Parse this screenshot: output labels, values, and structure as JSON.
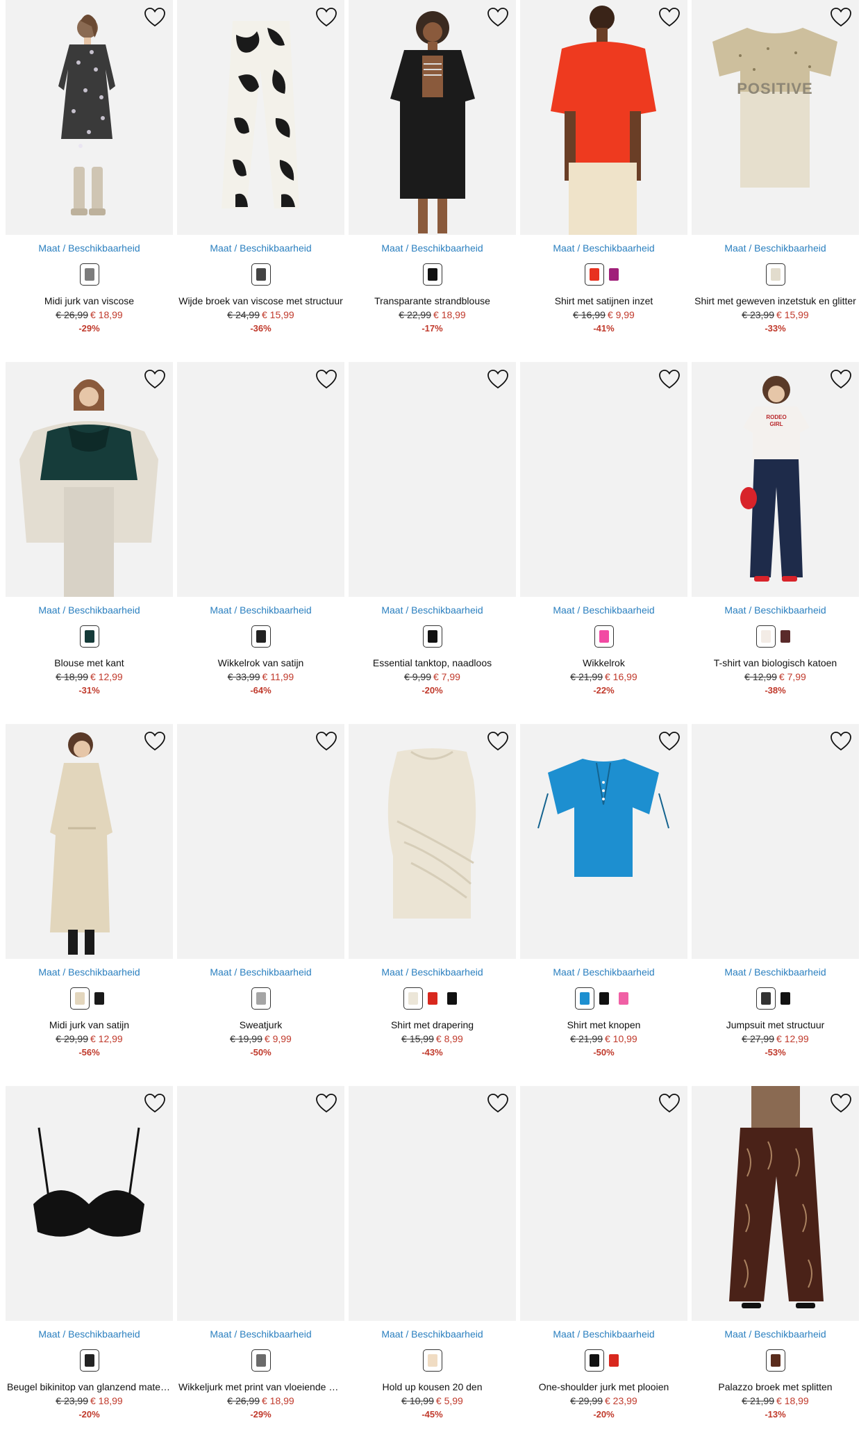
{
  "size_link_label": "Maat / Beschikbaarheid",
  "colors": {
    "link": "#2a7fbf",
    "sale": "#c0392b",
    "placeholder": "#f2f2f2"
  },
  "products": [
    {
      "name": "Midi jurk van viscose",
      "old": "€ 26,99",
      "new": "€ 18,99",
      "disc": "-29%",
      "image": "floral-dress-model",
      "swatches": [
        "#7c7c7c"
      ]
    },
    {
      "name": "Wijde broek van viscose met structuur",
      "old": "€ 24,99",
      "new": "€ 15,99",
      "disc": "-36%",
      "image": "patterned-trousers",
      "swatches": [
        "#444444"
      ]
    },
    {
      "name": "Transparante strandblouse",
      "old": "€ 22,99",
      "new": "€ 18,99",
      "disc": "-17%",
      "image": "black-beach-blouse-model",
      "swatches": [
        "#111111"
      ]
    },
    {
      "name": "Shirt met satijnen inzet",
      "old": "€ 16,99",
      "new": "€ 9,99",
      "disc": "-41%",
      "image": "red-shirt-model",
      "swatches": [
        "#e8321f",
        "#a0207a"
      ]
    },
    {
      "name": "Shirt met geweven inzetstuk en glitter",
      "old": "€ 23,99",
      "new": "€ 15,99",
      "disc": "-33%",
      "image": "positive-tshirt",
      "swatches": [
        "#e2dccd"
      ]
    },
    {
      "name": "Blouse met kant",
      "old": "€ 18,99",
      "new": "€ 12,99",
      "disc": "-31%",
      "image": "green-lace-blouse-model",
      "swatches": [
        "#143a38"
      ]
    },
    {
      "name": "Wikkelrok van satijn",
      "old": "€ 33,99",
      "new": "€ 11,99",
      "disc": "-64%",
      "image": "",
      "swatches": [
        "#222222"
      ]
    },
    {
      "name": "Essential tanktop, naadloos",
      "old": "€ 9,99",
      "new": "€ 7,99",
      "disc": "-20%",
      "image": "",
      "swatches": [
        "#111111"
      ]
    },
    {
      "name": "Wikkelrok",
      "old": "€ 21,99",
      "new": "€ 16,99",
      "disc": "-22%",
      "image": "",
      "swatches": [
        "#f24aa3"
      ]
    },
    {
      "name": "T-shirt van biologisch katoen",
      "old": "€ 12,99",
      "new": "€ 7,99",
      "disc": "-38%",
      "image": "tshirt-jeans-model",
      "swatches": [
        "#f3ece6",
        "#5a2a2a"
      ]
    },
    {
      "name": "Midi jurk van satijn",
      "old": "€ 29,99",
      "new": "€ 12,99",
      "disc": "-56%",
      "image": "beige-satin-dress-model",
      "swatches": [
        "#e3d6bd",
        "#1a1a1a"
      ]
    },
    {
      "name": "Sweatjurk",
      "old": "€ 19,99",
      "new": "€ 9,99",
      "disc": "-50%",
      "image": "",
      "swatches": [
        "#a5a5a5"
      ]
    },
    {
      "name": "Shirt met drapering",
      "old": "€ 15,99",
      "new": "€ 8,99",
      "disc": "-43%",
      "image": "draped-top",
      "swatches": [
        "#ece6d8",
        "#d8281e",
        "#111111"
      ]
    },
    {
      "name": "Shirt met knopen",
      "old": "€ 21,99",
      "new": "€ 10,99",
      "disc": "-50%",
      "image": "blue-button-shirt",
      "swatches": [
        "#1d8fd0",
        "#111111",
        "#f060a5"
      ]
    },
    {
      "name": "Jumpsuit met structuur",
      "old": "€ 27,99",
      "new": "€ 12,99",
      "disc": "-53%",
      "image": "",
      "swatches": [
        "#333333",
        "#111111"
      ]
    },
    {
      "name": "Beugel bikinitop van glanzend materiaal",
      "old": "€ 23,99",
      "new": "€ 18,99",
      "disc": "-20%",
      "image": "black-bikini-top",
      "swatches": [
        "#222222"
      ]
    },
    {
      "name": "Wikkeljurk met print van vloeiende viscose",
      "old": "€ 26,99",
      "new": "€ 18,99",
      "disc": "-29%",
      "image": "",
      "swatches": [
        "#6b6b6b"
      ]
    },
    {
      "name": "Hold up kousen 20 den",
      "old": "€ 10,99",
      "new": "€ 5,99",
      "disc": "-45%",
      "image": "",
      "swatches": [
        "#f0dcc3"
      ]
    },
    {
      "name": "One-shoulder jurk met plooien",
      "old": "€ 29,99",
      "new": "€ 23,99",
      "disc": "-20%",
      "image": "",
      "swatches": [
        "#111111",
        "#d8281e"
      ]
    },
    {
      "name": "Palazzo broek met splitten",
      "old": "€ 21,99",
      "new": "€ 18,99",
      "disc": "-13%",
      "image": "brown-palazzo-pants-model",
      "swatches": [
        "#5a2c1c"
      ]
    }
  ]
}
